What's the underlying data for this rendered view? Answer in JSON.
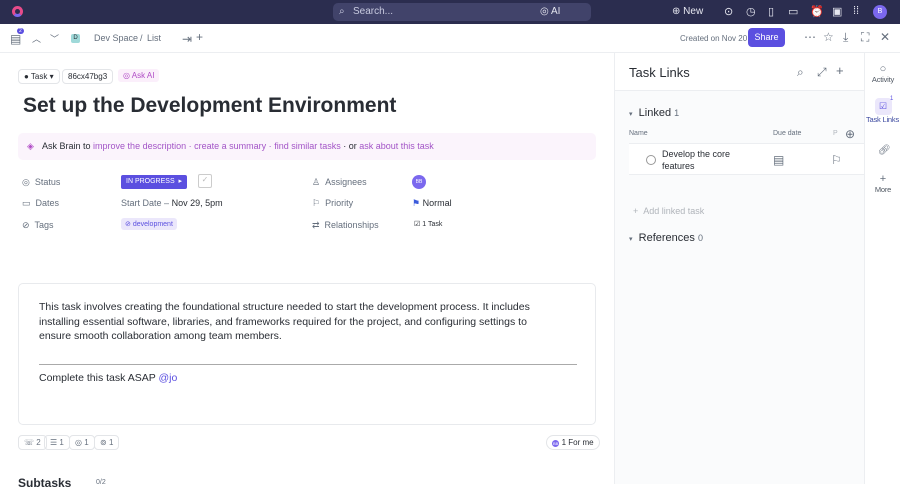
{
  "topbar": {
    "search_placeholder": "Search...",
    "ai": "AI",
    "new": "New",
    "avatar": "B"
  },
  "subbar": {
    "badge": "2",
    "space_initial": "D",
    "space": "Dev Space",
    "sep": "/",
    "list": "List",
    "created": "Created on Nov 20",
    "share": "Share"
  },
  "task": {
    "type": "Task",
    "id": "86cx47bg3",
    "ask_ai": "Ask AI",
    "title": "Set up the Development Environment"
  },
  "brain": {
    "prefix": "Ask Brain to",
    "l1": "improve the description",
    "d1": "·",
    "l2": "create a summary",
    "d2": "·",
    "l3": "find similar tasks",
    "d3": "· or",
    "l4": "ask about this task"
  },
  "fields": {
    "status_label": "Status",
    "status": "IN PROGRESS",
    "dates_label": "Dates",
    "start": "Start Date",
    "dash": "–",
    "due": "Nov 29, 5pm",
    "tags_label": "Tags",
    "tag": "development",
    "assignees_label": "Assignees",
    "assignee": "BB",
    "priority_label": "Priority",
    "priority": "Normal",
    "relationships_label": "Relationships",
    "relationships": "1 Task"
  },
  "description": {
    "body": "This task involves creating the foundational structure needed to start the development process. It includes installing essential software, libraries, and frameworks required for the project, and configuring settings to ensure smooth collaboration among team members.",
    "note": "Complete this task ASAP",
    "mention": "@jo"
  },
  "footer": {
    "c1": "2",
    "c2": "1",
    "c3": "1",
    "c4": "1",
    "assignee": "BB",
    "for_me": "1 For me",
    "subtasks": "Subtasks",
    "sub_count": "0/2"
  },
  "links": {
    "title": "Task Links",
    "linked": "Linked",
    "linked_count": "1",
    "col_name": "Name",
    "col_due": "Due date",
    "col_p": "P",
    "item": "Develop the core features",
    "add": "Add linked task",
    "refs": "References",
    "refs_count": "0"
  },
  "rail": {
    "activity": "Activity",
    "links": "Task Links",
    "links_badge": "1",
    "more": "More"
  },
  "colors": {
    "accent": "#5b4fe0",
    "topbar": "#2b2d4f"
  }
}
